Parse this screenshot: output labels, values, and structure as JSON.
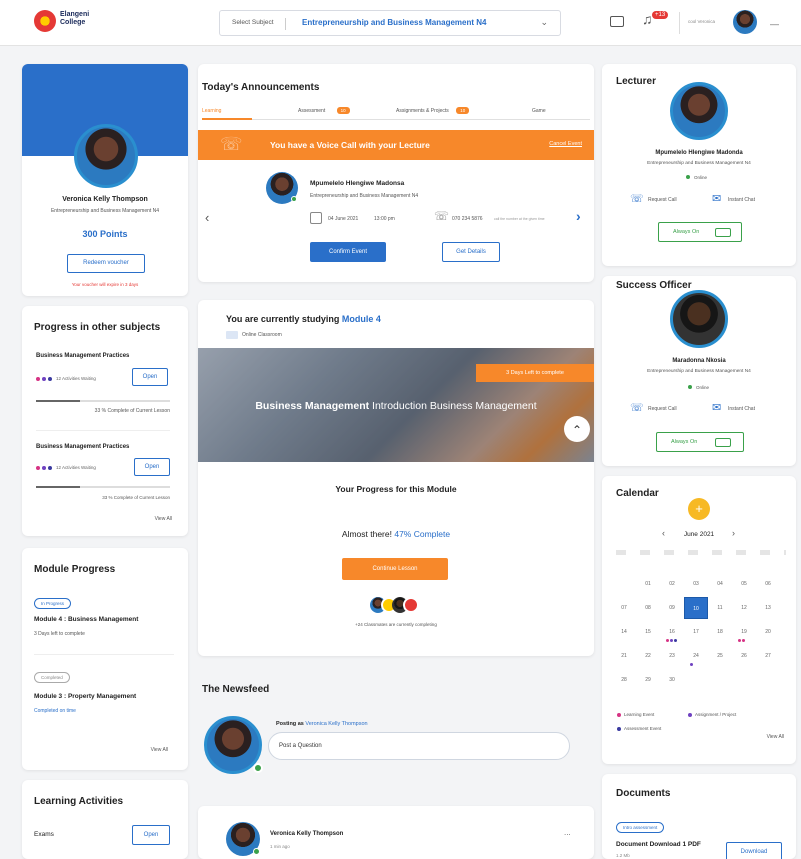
{
  "header": {
    "logo_line1": "Elangeni",
    "logo_line2": "College",
    "subject_label": "Select Subject",
    "subject_value": "Entrepreneurship and Business Management N4",
    "notif_count": "+13",
    "user_name": "cool Veronica"
  },
  "profile": {
    "name": "Veronica Kelly Thompson",
    "course": "Entrepreneurship and Business Management N4",
    "points": "300 Points",
    "redeem_label": "Redeem voucher",
    "expiry_note": "Your voucher will expire in 3 days"
  },
  "progress_other": {
    "title": "Progress in other subjects",
    "items": [
      {
        "name": "Business Management Practices",
        "status": "12 Activities Waiting",
        "open": "Open",
        "pct": "33 % Complete of Current Lesson",
        "fill": 0.33
      },
      {
        "name": "Business Management Practices",
        "status": "12 Activities Waiting",
        "open": "Open",
        "pct": "33 % Complete of Current Lesson",
        "fill": 0.33
      }
    ],
    "view_all": "View All"
  },
  "module_progress": {
    "title": "Module Progress",
    "items": [
      {
        "badge": "In Progress",
        "name": "Module 4 : Business Management",
        "sub": "3 Days left to complete"
      },
      {
        "badge": "Completed",
        "name": "Module 3 : Property Management",
        "sub": "Completed on time"
      }
    ],
    "view_all": "View All"
  },
  "learning_activities": {
    "title": "Learning Activities",
    "row_label": "Exams",
    "open": "Open"
  },
  "announcements": {
    "title": "Today's Announcements",
    "tabs": [
      {
        "label": "Learning",
        "badge": ""
      },
      {
        "label": "Assessment",
        "badge": "10"
      },
      {
        "label": "Assignments & Projects",
        "badge": "10"
      },
      {
        "label": "Game",
        "badge": ""
      }
    ],
    "banner_text": "You have a Voice Call with your Lecture",
    "cancel_label": "Cancel Event",
    "caller_name": "Mpumelelo Hlengiwe Madonsa",
    "caller_course": "Entrepreneurship and Business Management N4",
    "date": "04 June 2021",
    "time": "13:00 pm",
    "phone": "070 234 5876",
    "phone_note": "call the number at the given time",
    "confirm_label": "Confirm Event",
    "details_label": "Get Details"
  },
  "module": {
    "studying_prefix": "You are currently studying",
    "module_name": "Module 4",
    "classroom": "Online Classroom",
    "days_left": "3 Days Left to complete",
    "hero_bold": "Business Management",
    "hero_rest": "Introduction Business Management",
    "progress_title": "Your Progress for this Module",
    "almost_prefix": "Almost there!",
    "almost_pct": "47% Complete",
    "continue_label": "Continue Lesson",
    "classmates_note": "+24 Classmates are currently completing"
  },
  "newsfeed": {
    "title": "The Newsfeed",
    "posting_prefix": "Posting as",
    "posting_name": "Veronica Kelly Thompson",
    "placeholder": "Post a Question",
    "post_name": "Veronica Kelly Thompson",
    "post_time": "1 min ago",
    "post_menu": "..."
  },
  "lecturer": {
    "title": "Lecturer",
    "name": "Mpumelelo Hlengiwe Madonda",
    "course": "Entrepreneurship and Business Management N4",
    "status": "Online",
    "request_call": "Request Call",
    "instant_chat": "Instant Chat",
    "always_on": "Always On"
  },
  "success_officer": {
    "title": "Success Officer",
    "name": "Maradonna Nkosia",
    "course": "Entrepreneurship and Business Management N4",
    "status": "Online",
    "request_call": "Request Call",
    "instant_chat": "Instant Chat",
    "always_on": "Always On"
  },
  "calendar": {
    "title": "Calendar",
    "add": "+",
    "month": "June 2021",
    "prev": "‹",
    "next": "›",
    "weeks": [
      [
        "",
        "01",
        "02",
        "03",
        "04",
        "05",
        "06"
      ],
      [
        "07",
        "08",
        "09",
        "10",
        "11",
        "12",
        "13"
      ],
      [
        "14",
        "15",
        "16",
        "17",
        "18",
        "19",
        "20"
      ],
      [
        "21",
        "22",
        "23",
        "24",
        "25",
        "26",
        "27"
      ],
      [
        "28",
        "29",
        "30",
        "",
        "",
        "",
        ""
      ]
    ],
    "legend": [
      "Learning Event",
      "Assignment / Project",
      "Assessment Event"
    ],
    "view_all": "View All",
    "colors": {
      "learning": "#d63384",
      "assignment": "#6f42c1",
      "assessment": "#3a3aa0"
    }
  },
  "documents": {
    "title": "Documents",
    "badge": "Intro assessment",
    "doc_name": "Document Download 1 PDF",
    "doc_size": "1.2 Mb",
    "download": "Download"
  },
  "colors": {
    "primary": "#2a6fc9",
    "accent": "#f7882a",
    "success": "#3aa14a"
  }
}
